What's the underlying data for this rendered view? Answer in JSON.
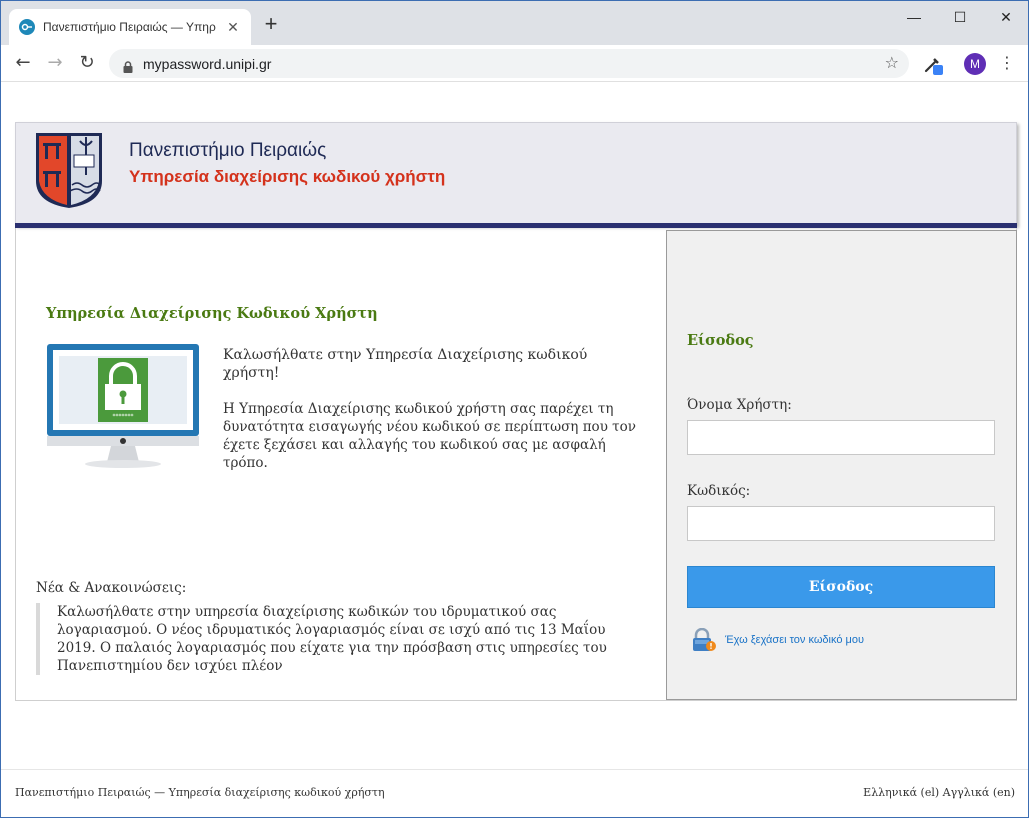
{
  "browser": {
    "tab_title": "Πανεπιστήμιο Πειραιώς — Υπηρ",
    "tab_close": "✕",
    "new_tab": "+",
    "url": "mypassword.unipi.gr",
    "avatar_letter": "M",
    "window_controls": {
      "minimize": "—",
      "maximize": "☐",
      "close": "✕"
    },
    "icons": [
      "back-arrow-icon",
      "forward-arrow-icon",
      "reload-icon",
      "lock-icon",
      "star-icon",
      "eyedropper-extension-icon",
      "menu-dots-icon"
    ]
  },
  "header": {
    "university": "Πανεπιστήμιο Πειραιώς",
    "service": "Υπηρεσία διαχείρισης κωδικού χρήστη"
  },
  "main": {
    "title": "Υπηρεσία Διαχείρισης Κωδικού Χρήστη",
    "welcome": "Καλωσήλθατε στην Υπηρεσία Διαχείρισης κωδικού χρήστη!",
    "description": "Η Υπηρεσία Διαχείρισης κωδικού χρήστη σας παρέχει τη δυνατότητα εισαγωγής νέου κωδικού σε περίπτωση που τον έχετε ξεχάσει και αλλαγής του κωδικού σας με ασφαλή τρόπο.",
    "news_heading": "Νέα & Ανακοινώσεις:",
    "news_text": "Καλωσήλθατε στην υπηρεσία διαχείρισης κωδικών του ιδρυματικού σας λογαριασμού. Ο νέος ιδρυματικός λογαριασμός είναι σε ισχύ από τις 13 Μαΐου 2019. Ο παλαιός λογαριασμός που είχατε για την πρόσβαση στις υπηρεσίες του Πανεπιστημίου δεν ισχύει πλέον"
  },
  "login": {
    "title": "Είσοδος",
    "username_label": "Όνομα Χρήστη:",
    "username_value": "",
    "password_label": "Κωδικός:",
    "password_value": "",
    "submit_label": "Είσοδος",
    "forgot_link": "Έχω ξεχάσει τον κωδικό μου"
  },
  "footer": {
    "left": "Πανεπιστήμιο Πειραιώς — Υπηρεσία διαχείρισης κωδικού χρήστη",
    "right": "Ελληνικά (el) Αγγλικά (en)"
  },
  "colors": {
    "accent_green": "#4a7a12",
    "accent_red": "#d4321c",
    "header_bar": "#2a3070",
    "button_blue": "#3a99ea",
    "link_blue": "#1a73c7"
  }
}
